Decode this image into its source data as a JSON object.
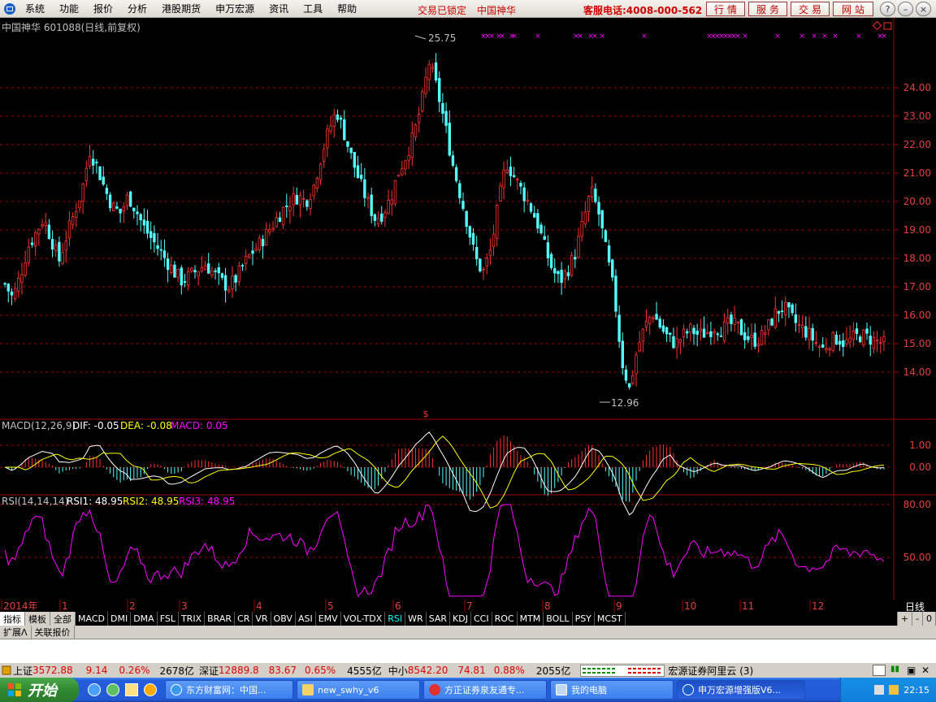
{
  "menu": {
    "items": [
      "系统",
      "功能",
      "报价",
      "分析",
      "港股期货",
      "申万宏源",
      "资讯",
      "工具",
      "帮助"
    ],
    "lock_text": "交易已锁定",
    "stock_name_red": "中国神华",
    "service_phone": "客服电话:4008-000-562",
    "quick_buttons": [
      "行情",
      "服务",
      "交易",
      "网站"
    ]
  },
  "chart": {
    "header": "中国神华 601088(日线,前复权)",
    "high_label": "25.75",
    "low_label": "12.96",
    "period_label": "日线",
    "macd_header": {
      "prefix": "MACD(12,26,9)",
      "dif": "DIF: -0.05",
      "dea": "DEA: -0.08",
      "macd": "MACD: 0.05"
    },
    "rsi_header": {
      "prefix": "RSI(14,14,14)",
      "rsi1": "RSI1: 48.95",
      "rsi2": "RSI2: 48.95",
      "rsi3": "RSI3: 48.95"
    },
    "colors": {
      "up": "#ff3232",
      "down": "#54ffff",
      "dif": "#ffffff",
      "dea": "#ffff00",
      "rsi": "#ff00ff",
      "axis": "#a00000"
    }
  },
  "chart_data": {
    "type": "candlestick",
    "symbol": "601088",
    "price_axis": {
      "ticks": [
        24.0,
        23.0,
        22.0,
        21.0,
        20.0,
        19.0,
        18.0,
        17.0,
        16.0,
        15.0,
        14.0
      ],
      "min": 12.5,
      "max": 26.2
    },
    "macd_axis": {
      "ticks": [
        "1.00",
        "0.00"
      ]
    },
    "rsi_axis": {
      "ticks": [
        "80.00",
        "50.00"
      ]
    },
    "x_labels": [
      "2014年",
      "1",
      "2",
      "3",
      "4",
      "5",
      "6",
      "7",
      "8",
      "9",
      "10",
      "11",
      "12"
    ],
    "close_path": [
      17.1,
      16.6,
      17.4,
      18.4,
      18.9,
      19.4,
      18.7,
      17.9,
      18.8,
      19.6,
      20.4,
      21.8,
      21.2,
      20.4,
      19.8,
      19.6,
      20.2,
      19.7,
      19.1,
      18.7,
      18.3,
      17.9,
      17.5,
      17.2,
      17.4,
      17.6,
      17.8,
      17.5,
      17.2,
      17.0,
      17.3,
      17.8,
      18.2,
      18.5,
      18.9,
      19.3,
      19.7,
      20.0,
      20.2,
      20.0,
      20.5,
      21.6,
      22.5,
      23.2,
      22.4,
      21.5,
      20.7,
      20.0,
      19.4,
      19.6,
      20.1,
      21.0,
      21.6,
      22.3,
      23.4,
      24.9,
      24.0,
      22.8,
      21.4,
      20.3,
      19.2,
      18.0,
      17.5,
      18.3,
      19.9,
      21.4,
      20.9,
      20.4,
      19.9,
      19.3,
      18.4,
      17.6,
      17.2,
      17.6,
      18.2,
      19.3,
      20.4,
      19.6,
      18.2,
      16.8,
      14.4,
      13.4,
      14.8,
      15.6,
      16.1,
      15.6,
      15.2,
      15.0,
      15.3,
      15.5,
      15.3,
      15.4,
      15.6,
      15.5,
      15.7,
      15.6,
      15.3,
      15.1,
      15.2,
      15.6,
      16.1,
      16.3,
      15.9,
      15.6,
      15.4,
      15.1,
      14.8,
      15.1,
      15.2,
      15.0,
      15.2,
      15.3,
      15.2,
      15.1,
      15.0
    ]
  },
  "tabs": {
    "controls": [
      "指标",
      "模板",
      "全部"
    ],
    "indicators": [
      "MACD",
      "DMI",
      "DMA",
      "FSL",
      "TRIX",
      "BRAR",
      "CR",
      "VR",
      "OBV",
      "ASI",
      "EMV",
      "VOL-TDX",
      "RSI",
      "WR",
      "SAR",
      "KDJ",
      "CCI",
      "ROC",
      "MTM",
      "BOLL",
      "PSY",
      "MCST"
    ],
    "active_indicator": "RSI",
    "right_controls": [
      "+",
      "-",
      "0"
    ],
    "ext": [
      "扩展Λ",
      "关联报价"
    ]
  },
  "status": {
    "sh_label": "上证",
    "sh_value": "3572.88",
    "sh_change": "9.14",
    "sh_pct": "0.26%",
    "sh_amount": "2678亿",
    "sz_label": "深证",
    "sz_value": "12889.8",
    "sz_change": "83.67",
    "sz_pct": "0.65%",
    "sz_amount": "4555亿",
    "zx_label": "中小",
    "zx_value": "8542.20",
    "zx_change": "74.81",
    "zx_pct": "0.88%",
    "zx_amount": "2055亿",
    "broker": "宏源证券阿里云 (3)"
  },
  "taskbar": {
    "start": "开始",
    "tasks": [
      "东方财富网：中国...",
      "new_swhy_v6",
      "方正证券泉友通专...",
      "我的电脑",
      "申万宏源增强版V6..."
    ],
    "clock": "22:15"
  }
}
